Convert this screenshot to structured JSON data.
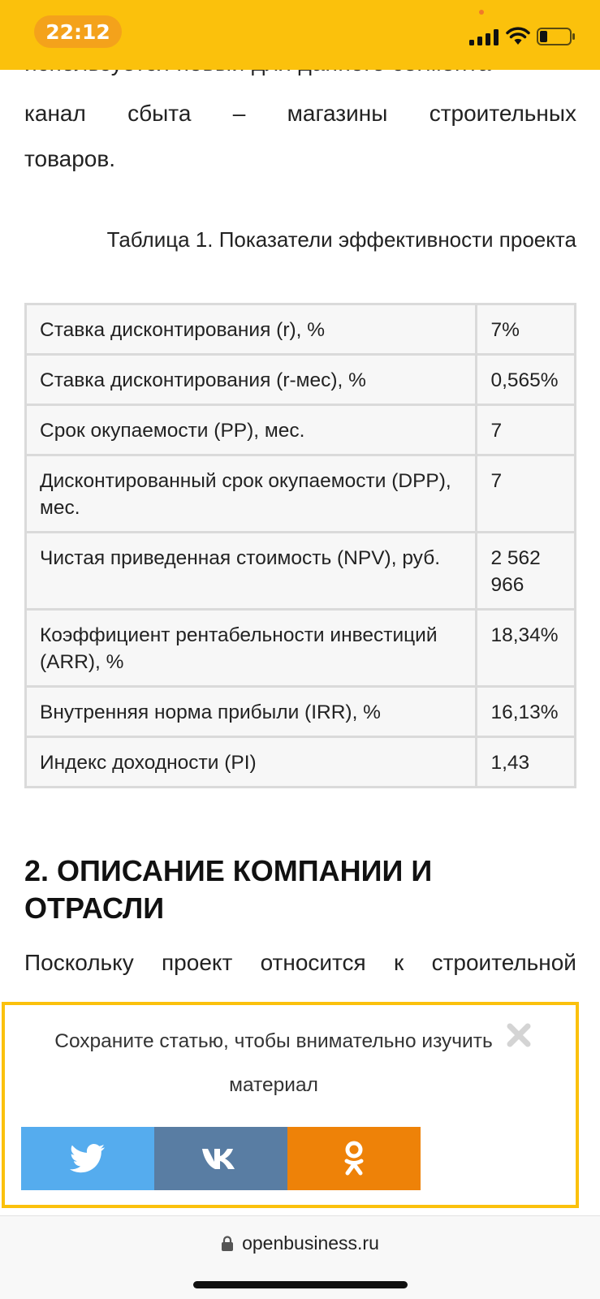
{
  "status_bar": {
    "time": "22:12"
  },
  "article": {
    "partial_line": "используется новый для данного сегмента",
    "paragraph1_lines": [
      [
        "канал",
        "сбыта",
        "–",
        "магазины",
        "строительных"
      ],
      [
        "товаров."
      ]
    ],
    "table_caption": "Таблица 1. Показатели эффективности проекта",
    "table_rows": [
      {
        "label": "Ставка дисконтирования (r), %",
        "value": "7%"
      },
      {
        "label": "Ставка дисконтирования (r-мес), %",
        "value": "0,565%"
      },
      {
        "label": "Срок окупаемости (PP), мес.",
        "value": "7"
      },
      {
        "label": "Дисконтированный срок окупаемости (DPP), мес.",
        "value": "7"
      },
      {
        "label": "Чистая приведенная стоимость (NPV), руб.",
        "value": "2 562 966"
      },
      {
        "label": "Коэффициент рентабельности инвестиций (ARR), %",
        "value": "18,34%"
      },
      {
        "label": "Внутренняя норма прибыли (IRR), %",
        "value": "16,13%"
      },
      {
        "label": "Индекс доходности (PI)",
        "value": "1,43"
      }
    ],
    "section_title": "2. ОПИСАНИЕ КОМПАНИИ И ОТРАСЛИ",
    "paragraph2_words": [
      "Поскольку",
      "проект",
      "относится",
      "к",
      "строительной"
    ]
  },
  "save_popup": {
    "text": "Сохраните статью, чтобы внимательно изучить материал",
    "share_buttons": [
      {
        "icon": "twitter-icon",
        "color": "#55acee"
      },
      {
        "icon": "vk-icon",
        "color": "#597da3"
      },
      {
        "icon": "odnoklassniki-icon",
        "color": "#ee8208"
      }
    ]
  },
  "browser": {
    "url": "openbusiness.ru"
  },
  "colors": {
    "accent": "#fbc10c",
    "time_pill": "#f4a21b"
  }
}
